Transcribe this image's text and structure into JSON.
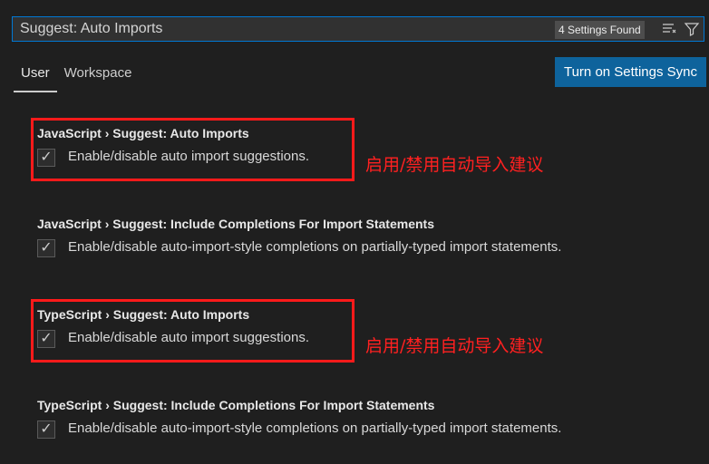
{
  "search": {
    "value": "Suggest: Auto Imports",
    "results_count": "4 Settings Found",
    "clear_icon": "clear-filter-icon",
    "filter_icon": "filter-icon"
  },
  "tabs": [
    {
      "label": "User",
      "active": true
    },
    {
      "label": "Workspace",
      "active": false
    }
  ],
  "sync_button_label": "Turn on Settings Sync",
  "settings": [
    {
      "category": "JavaScript",
      "separator": "›",
      "name": "Suggest: Auto Imports",
      "description": "Enable/disable auto import suggestions.",
      "checked": true,
      "annotated": true
    },
    {
      "category": "JavaScript",
      "separator": "›",
      "name": "Suggest: Include Completions For Import Statements",
      "description": "Enable/disable auto-import-style completions on partially-typed import statements.",
      "checked": true,
      "annotated": false
    },
    {
      "category": "TypeScript",
      "separator": "›",
      "name": "Suggest: Auto Imports",
      "description": "Enable/disable auto import suggestions.",
      "checked": true,
      "annotated": true
    },
    {
      "category": "TypeScript",
      "separator": "›",
      "name": "Suggest: Include Completions For Import Statements",
      "description": "Enable/disable auto-import-style completions on partially-typed import statements.",
      "checked": true,
      "annotated": false
    }
  ],
  "annotations": [
    {
      "label": "启用/禁用自动导入建议"
    },
    {
      "label": "启用/禁用自动导入建议"
    }
  ],
  "colors": {
    "accent": "#0e639c",
    "focus": "#0078d4",
    "annotation": "#ff2020",
    "background": "#1f1f1f"
  }
}
